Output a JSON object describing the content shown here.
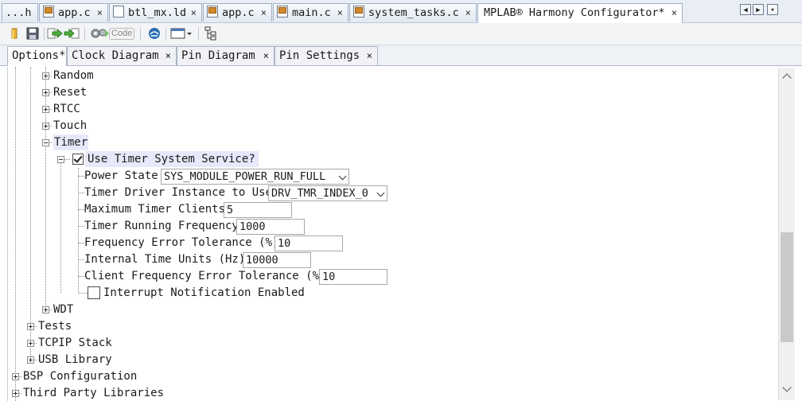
{
  "file_tabs": [
    {
      "label": "...h",
      "icon": "none"
    },
    {
      "label": "app.c",
      "icon": "c-file-icon"
    },
    {
      "label": "btl_mx.ld",
      "icon": "doc-file-icon"
    },
    {
      "label": "app.c",
      "icon": "c-file-icon"
    },
    {
      "label": "main.c",
      "icon": "c-file-icon"
    },
    {
      "label": "system_tasks.c",
      "icon": "c-file-icon"
    },
    {
      "label": "MPLAB® Harmony Configurator*",
      "icon": "none",
      "active": true
    }
  ],
  "file_tab_close": "×",
  "tab_nav": {
    "left": "◀",
    "right": "▶",
    "menu": "▾"
  },
  "toolbar": {
    "generate_label": "Code",
    "icons": [
      "open-folder-icon",
      "save-icon",
      "export-arrow-icon",
      "import-arrow-icon",
      "generate-code-icon",
      "harmony-logo-icon",
      "window-dropdown-icon",
      "tree-hierarchy-icon"
    ]
  },
  "config_tabs": [
    {
      "label": "Options*",
      "active": true,
      "closable": false
    },
    {
      "label": "Clock Diagram",
      "active": false,
      "closable": true
    },
    {
      "label": "Pin Diagram",
      "active": false,
      "closable": true
    },
    {
      "label": "Pin Settings",
      "active": false,
      "closable": true
    }
  ],
  "config_tab_close": "×",
  "tree": {
    "random": "Random",
    "reset": "Reset",
    "rtcc": "RTCC",
    "touch": "Touch",
    "timer": "Timer",
    "use_timer_service": {
      "label": "Use Timer System Service?",
      "checked": true
    },
    "power_state": {
      "label": "Power State",
      "value": "SYS_MODULE_POWER_RUN_FULL"
    },
    "driver_instance": {
      "label": "Timer Driver Instance to Use",
      "value": "DRV_TMR_INDEX_0"
    },
    "max_clients": {
      "label": "Maximum Timer Clients",
      "value": "5"
    },
    "running_freq": {
      "label": "Timer Running Frequency",
      "value": "1000"
    },
    "freq_error_tol": {
      "label": "Frequency Error Tolerance (%)",
      "value": "10"
    },
    "time_units": {
      "label": "Internal Time Units (Hz)",
      "value": "10000"
    },
    "client_freq_error_tol": {
      "label": "Client Frequency Error Tolerance (%)",
      "value": "10"
    },
    "interrupt_notification": {
      "label": "Interrupt Notification Enabled",
      "checked": false
    },
    "wdt": "WDT",
    "tests": "Tests",
    "tcpip": "TCPIP Stack",
    "usb": "USB Library",
    "bsp": "BSP Configuration",
    "third_party": "Third Party Libraries"
  },
  "scrollbar": {
    "position_fraction": 0.78
  }
}
